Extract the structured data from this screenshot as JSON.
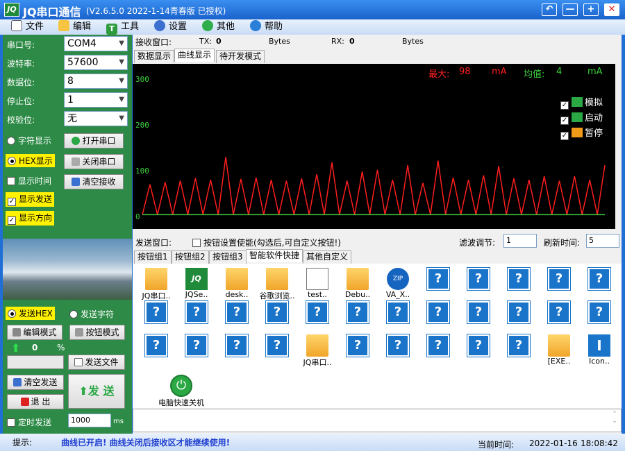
{
  "title": {
    "app": "JQ串口通信",
    "version": "(V2.6.5.0  2022-1-14青春版 已授权)",
    "logo": "JQ"
  },
  "window_buttons": [
    "back-icon",
    "minimize-icon",
    "maximize-icon",
    "close-icon"
  ],
  "menu": [
    {
      "label": "文件",
      "icon": "file-icon"
    },
    {
      "label": "编辑",
      "icon": "edit-icon"
    },
    {
      "label": "工具",
      "icon": "tools-icon"
    },
    {
      "label": "设置",
      "icon": "settings-icon"
    },
    {
      "label": "其他",
      "icon": "other-icon"
    },
    {
      "label": "帮助",
      "icon": "help-icon"
    }
  ],
  "serial": {
    "port_label": "串口号:",
    "port": "COM4",
    "baud_label": "波特率:",
    "baud": "57600",
    "data_label": "数据位:",
    "data": "8",
    "stop_label": "停止位:",
    "stop": "1",
    "parity_label": "校验位:",
    "parity": "无"
  },
  "left": {
    "char_display": "字符显示",
    "hex_display": "HEX显示",
    "show_time": "显示时间",
    "show_send": "显示发送",
    "show_direction": "显示方向",
    "open_port": "打开串口",
    "close_port": "关闭串口",
    "clear_recv": "清空接收",
    "send_hex": "发送HEX",
    "send_char": "发送字符",
    "edit_mode": "编辑模式",
    "button_mode": "按钮模式",
    "progress": "0",
    "percent": "%",
    "send_file": "发送文件",
    "clear_send": "清空发送",
    "send": "发 送",
    "exit": "退   出",
    "timed_send": "定时发送",
    "interval": "1000",
    "ms": "ms"
  },
  "rx": {
    "label": "接收窗口:",
    "tx_label": "TX:",
    "tx": "0",
    "bytes1": "Bytes",
    "rx_label": "RX:",
    "rx": "0",
    "bytes2": "Bytes"
  },
  "rx_tabs": [
    "数据显示",
    "曲线显示",
    "待开发模式"
  ],
  "chart": {
    "max_label": "最大:",
    "max": "98",
    "unit1": "mA",
    "avg_label": "均值:",
    "avg": "4",
    "unit2": "mA",
    "ylabels": [
      "300",
      "200",
      "100",
      "0"
    ],
    "legend": [
      "模拟",
      "启动",
      "暂停"
    ]
  },
  "chart_data": {
    "type": "line",
    "yticks": [
      0,
      100,
      200,
      300
    ],
    "ylim": [
      0,
      300
    ],
    "series": [
      {
        "name": "",
        "color": "#ff1e1e",
        "values": [
          4,
          70,
          4,
          75,
          4,
          78,
          4,
          84,
          4,
          80,
          4,
          130,
          4,
          82,
          4,
          85,
          4,
          80,
          4,
          78,
          4,
          83,
          4,
          92,
          4,
          118,
          4,
          78,
          4,
          98,
          4,
          102,
          4,
          80,
          4,
          112,
          4,
          73,
          4,
          122,
          4,
          85,
          4,
          80,
          4,
          90,
          4,
          110,
          4,
          83,
          4,
          80,
          4,
          88,
          4,
          78,
          4,
          88,
          4,
          80,
          4,
          112
        ]
      },
      {
        "name": "",
        "color": "#3cc83c",
        "values": [
          4,
          4,
          4,
          4,
          4,
          4,
          4,
          4,
          4,
          4,
          4,
          4,
          4,
          4,
          4,
          4,
          4,
          4,
          4,
          4,
          4,
          4,
          4,
          4,
          4,
          4,
          4,
          4,
          4,
          4,
          4,
          4,
          4,
          4,
          4,
          4,
          4,
          4,
          4,
          4,
          4,
          4,
          4,
          4,
          4,
          4,
          4,
          4,
          4,
          4,
          4,
          4,
          4,
          4,
          4,
          4,
          4,
          4,
          4,
          4,
          4,
          4
        ]
      }
    ]
  },
  "tx": {
    "label": "发送窗口:",
    "enable": "按钮设置使能(勾选后,可自定义按钮!)",
    "filter_label": "滤波调节:",
    "filter": "1",
    "refresh_label": "刷新时间:",
    "refresh": "5"
  },
  "tx_tabs": [
    "按钮组1",
    "按钮组2",
    "按钮组3",
    "智能软件快捷",
    "其他自定义"
  ],
  "grid_row1": [
    {
      "label": "JQ串口..",
      "icon": "folder-icon"
    },
    {
      "label": "JQSe..",
      "icon": "jq-app-icon"
    },
    {
      "label": "desk..",
      "icon": "folder-icon"
    },
    {
      "label": "谷歌浏览..",
      "icon": "folder-icon"
    },
    {
      "label": "test..",
      "icon": "notepad-icon"
    },
    {
      "label": "Debu..",
      "icon": "folder-icon"
    },
    {
      "label": "VA_X..",
      "icon": "zip-icon"
    },
    {
      "label": "",
      "icon": "unknown-icon"
    },
    {
      "label": "",
      "icon": "unknown-icon"
    },
    {
      "label": "",
      "icon": "unknown-icon"
    },
    {
      "label": "",
      "icon": "unknown-icon"
    },
    {
      "label": "",
      "icon": "unknown-icon"
    }
  ],
  "grid_row3": [
    {
      "label": "",
      "icon": "unknown-icon"
    },
    {
      "label": "",
      "icon": "unknown-icon"
    },
    {
      "label": "",
      "icon": "unknown-icon"
    },
    {
      "label": "",
      "icon": "unknown-icon"
    },
    {
      "label": "JQ串口..",
      "icon": "folder-icon"
    },
    {
      "label": "",
      "icon": "unknown-icon"
    },
    {
      "label": "",
      "icon": "unknown-icon"
    },
    {
      "label": "",
      "icon": "unknown-icon"
    },
    {
      "label": "",
      "icon": "unknown-icon"
    },
    {
      "label": "",
      "icon": "unknown-icon"
    },
    {
      "label": "[EXE..",
      "icon": "folder-icon"
    },
    {
      "label": "Icon..",
      "icon": "info-icon"
    }
  ],
  "shutdown": "电脑快速关机",
  "status": {
    "hint_label": "提示:",
    "hint": "曲线已开启! 曲线关闭后接收区才能继续使用!",
    "time_label": "当前时间:",
    "date": "2022-01-16",
    "time": "18:08:42"
  }
}
